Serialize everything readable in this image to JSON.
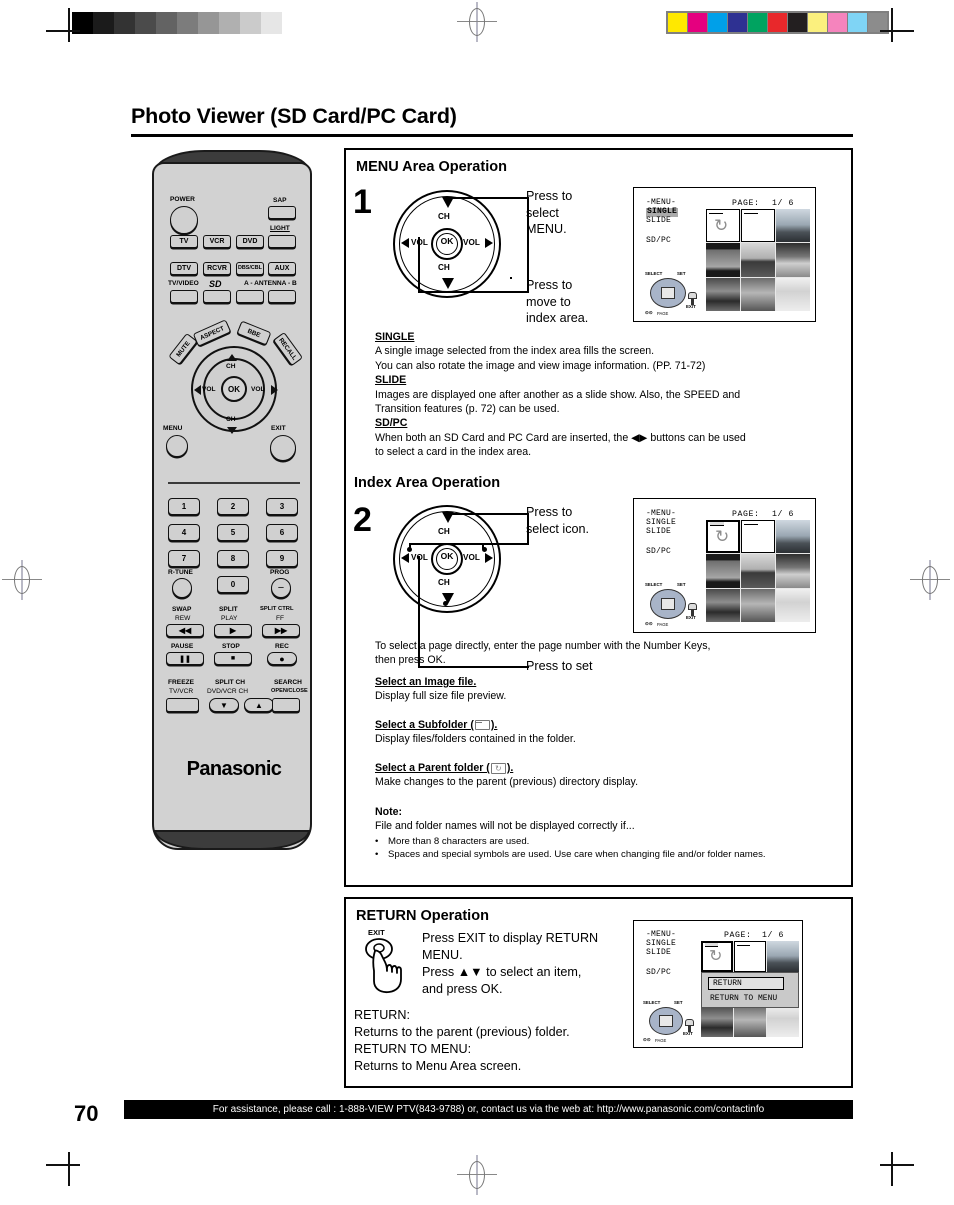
{
  "document": {
    "title": "Photo Viewer (SD Card/PC Card)",
    "page_number": "70",
    "footer": "For assistance, please call : 1-888-VIEW PTV(843-9788) or, contact us via the web at: http://www.panasonic.com/contactinfo"
  },
  "calibration": {
    "grayscale": [
      "#000000",
      "#1b1b1b",
      "#333333",
      "#4b4b4b",
      "#636363",
      "#7c7c7c",
      "#969696",
      "#b0b0b0",
      "#cbcbcb",
      "#e6e6e6",
      "#ffffff"
    ],
    "colors": [
      "#ffe800",
      "#e5007f",
      "#00a0e9",
      "#2e3192",
      "#00a360",
      "#e8282b",
      "#231f20",
      "#fbf07e",
      "#f584bd",
      "#7fd4f5",
      "#8c8c8c"
    ]
  },
  "remote": {
    "brand": "Panasonic",
    "power_label": "POWER",
    "sap_label": "SAP",
    "light_label": "LIGHT",
    "device_row1": [
      "TV",
      "VCR",
      "DVD"
    ],
    "device_row2": [
      "DTV",
      "RCVR",
      "DBS/CBL",
      "AUX"
    ],
    "input_labels": [
      "TV/VIDEO",
      "SD",
      "A - ANTENNA - B"
    ],
    "curved_buttons": [
      "MUTE",
      "ASPECT",
      "BBE",
      "RECALL"
    ],
    "wheel": {
      "up": "CH",
      "down": "CH",
      "left": "VOL",
      "right": "VOL",
      "center": "OK"
    },
    "menu_label": "MENU",
    "exit_label": "EXIT",
    "numbers": [
      "1",
      "2",
      "3",
      "4",
      "5",
      "6",
      "7",
      "8",
      "9",
      "0"
    ],
    "rtune_label": "R-TUNE",
    "prog_label": "PROG",
    "transport": [
      {
        "top": "SWAP",
        "sub": "REW",
        "glyph": "◀◀"
      },
      {
        "top": "SPLIT",
        "sub": "PLAY",
        "glyph": "▶"
      },
      {
        "top": "SPLIT CTRL",
        "sub": "FF",
        "glyph": "▶▶"
      },
      {
        "top": "PAUSE",
        "sub": "",
        "glyph": "❚❚"
      },
      {
        "top": "STOP",
        "sub": "",
        "glyph": "■"
      },
      {
        "top": "REC",
        "sub": "",
        "glyph": "●"
      }
    ],
    "bottom_row": [
      {
        "top": "FREEZE",
        "sub": "TV/VCR",
        "glyph": ""
      },
      {
        "top": "SPLIT CH",
        "sub": "DVD/VCR CH",
        "glyph": "▼"
      },
      {
        "top": "",
        "sub": "",
        "glyph": "▲"
      },
      {
        "top": "SEARCH",
        "sub": "OPEN/CLOSE",
        "glyph": ""
      }
    ]
  },
  "menu_area": {
    "heading": "MENU Area Operation",
    "step": "1",
    "callout_top": "Press to\nselect\nMENU.",
    "callout_bottom": "Press to\nmove to\nindex area.",
    "terms": [
      {
        "term": "SINGLE",
        "lines": [
          "A single image selected from the index area fills the screen.",
          "You can also rotate the image and view image information. (PP. 71-72)"
        ]
      },
      {
        "term": "SLIDE ",
        "lines": [
          "Images are displayed one after another as a slide show. Also, the SPEED and",
          "Transition features (p. 72) can be used."
        ]
      },
      {
        "term": "SD/PC",
        "lines": [
          "When both an SD Card and PC Card are inserted, the ◀▶ buttons can be used",
          "to select a card in the index area."
        ]
      }
    ]
  },
  "index_area": {
    "heading": "Index Area Operation",
    "step": "2",
    "callout_top": "Press to\nselect icon.",
    "callout_bottom": "Press to set",
    "intro": [
      "To select a page directly, enter the page number with the Number Keys,",
      "then press OK."
    ],
    "items": [
      {
        "term": "Select an Image file.",
        "desc": "Display full size file preview."
      },
      {
        "term": "Select a Subfolder (",
        "term_end": ").",
        "desc": "Display files/folders contained in the folder.",
        "icon": "folder-icon"
      },
      {
        "term": "Select a Parent folder (",
        "term_end": ").",
        "desc": "Make changes to the parent (previous) directory display.",
        "icon": "parent-folder-icon"
      }
    ],
    "note_label": "Note:",
    "note_intro": "File and folder names will not be displayed correctly if...",
    "note_bullets": [
      "More than 8 characters are used.",
      "Spaces and special symbols are used. Use care when changing file and/or folder names."
    ]
  },
  "return_area": {
    "heading": "RETURN Operation",
    "exit_label": "EXIT",
    "instructions": [
      "Press EXIT to display RETURN",
      "MENU.",
      "Press ▲▼ to select an item,",
      "and press OK."
    ],
    "definitions": [
      "RETURN:",
      "Returns to the parent (previous) folder.",
      "RETURN TO MENU:",
      "Returns to Menu Area screen."
    ]
  },
  "osd": {
    "menu_label": "-MENU-",
    "single": "SINGLE",
    "slide": "SLIDE",
    "sdpc": "SD/PC",
    "page_label": "PAGE:",
    "page_value": "1/ 6",
    "nav_select": "SELECT",
    "nav_set": "SET",
    "nav_exit": "EXIT",
    "nav_page": "PAGE",
    "return_menu": {
      "item1": "RETURN",
      "item2": "RETURN TO MENU"
    }
  }
}
